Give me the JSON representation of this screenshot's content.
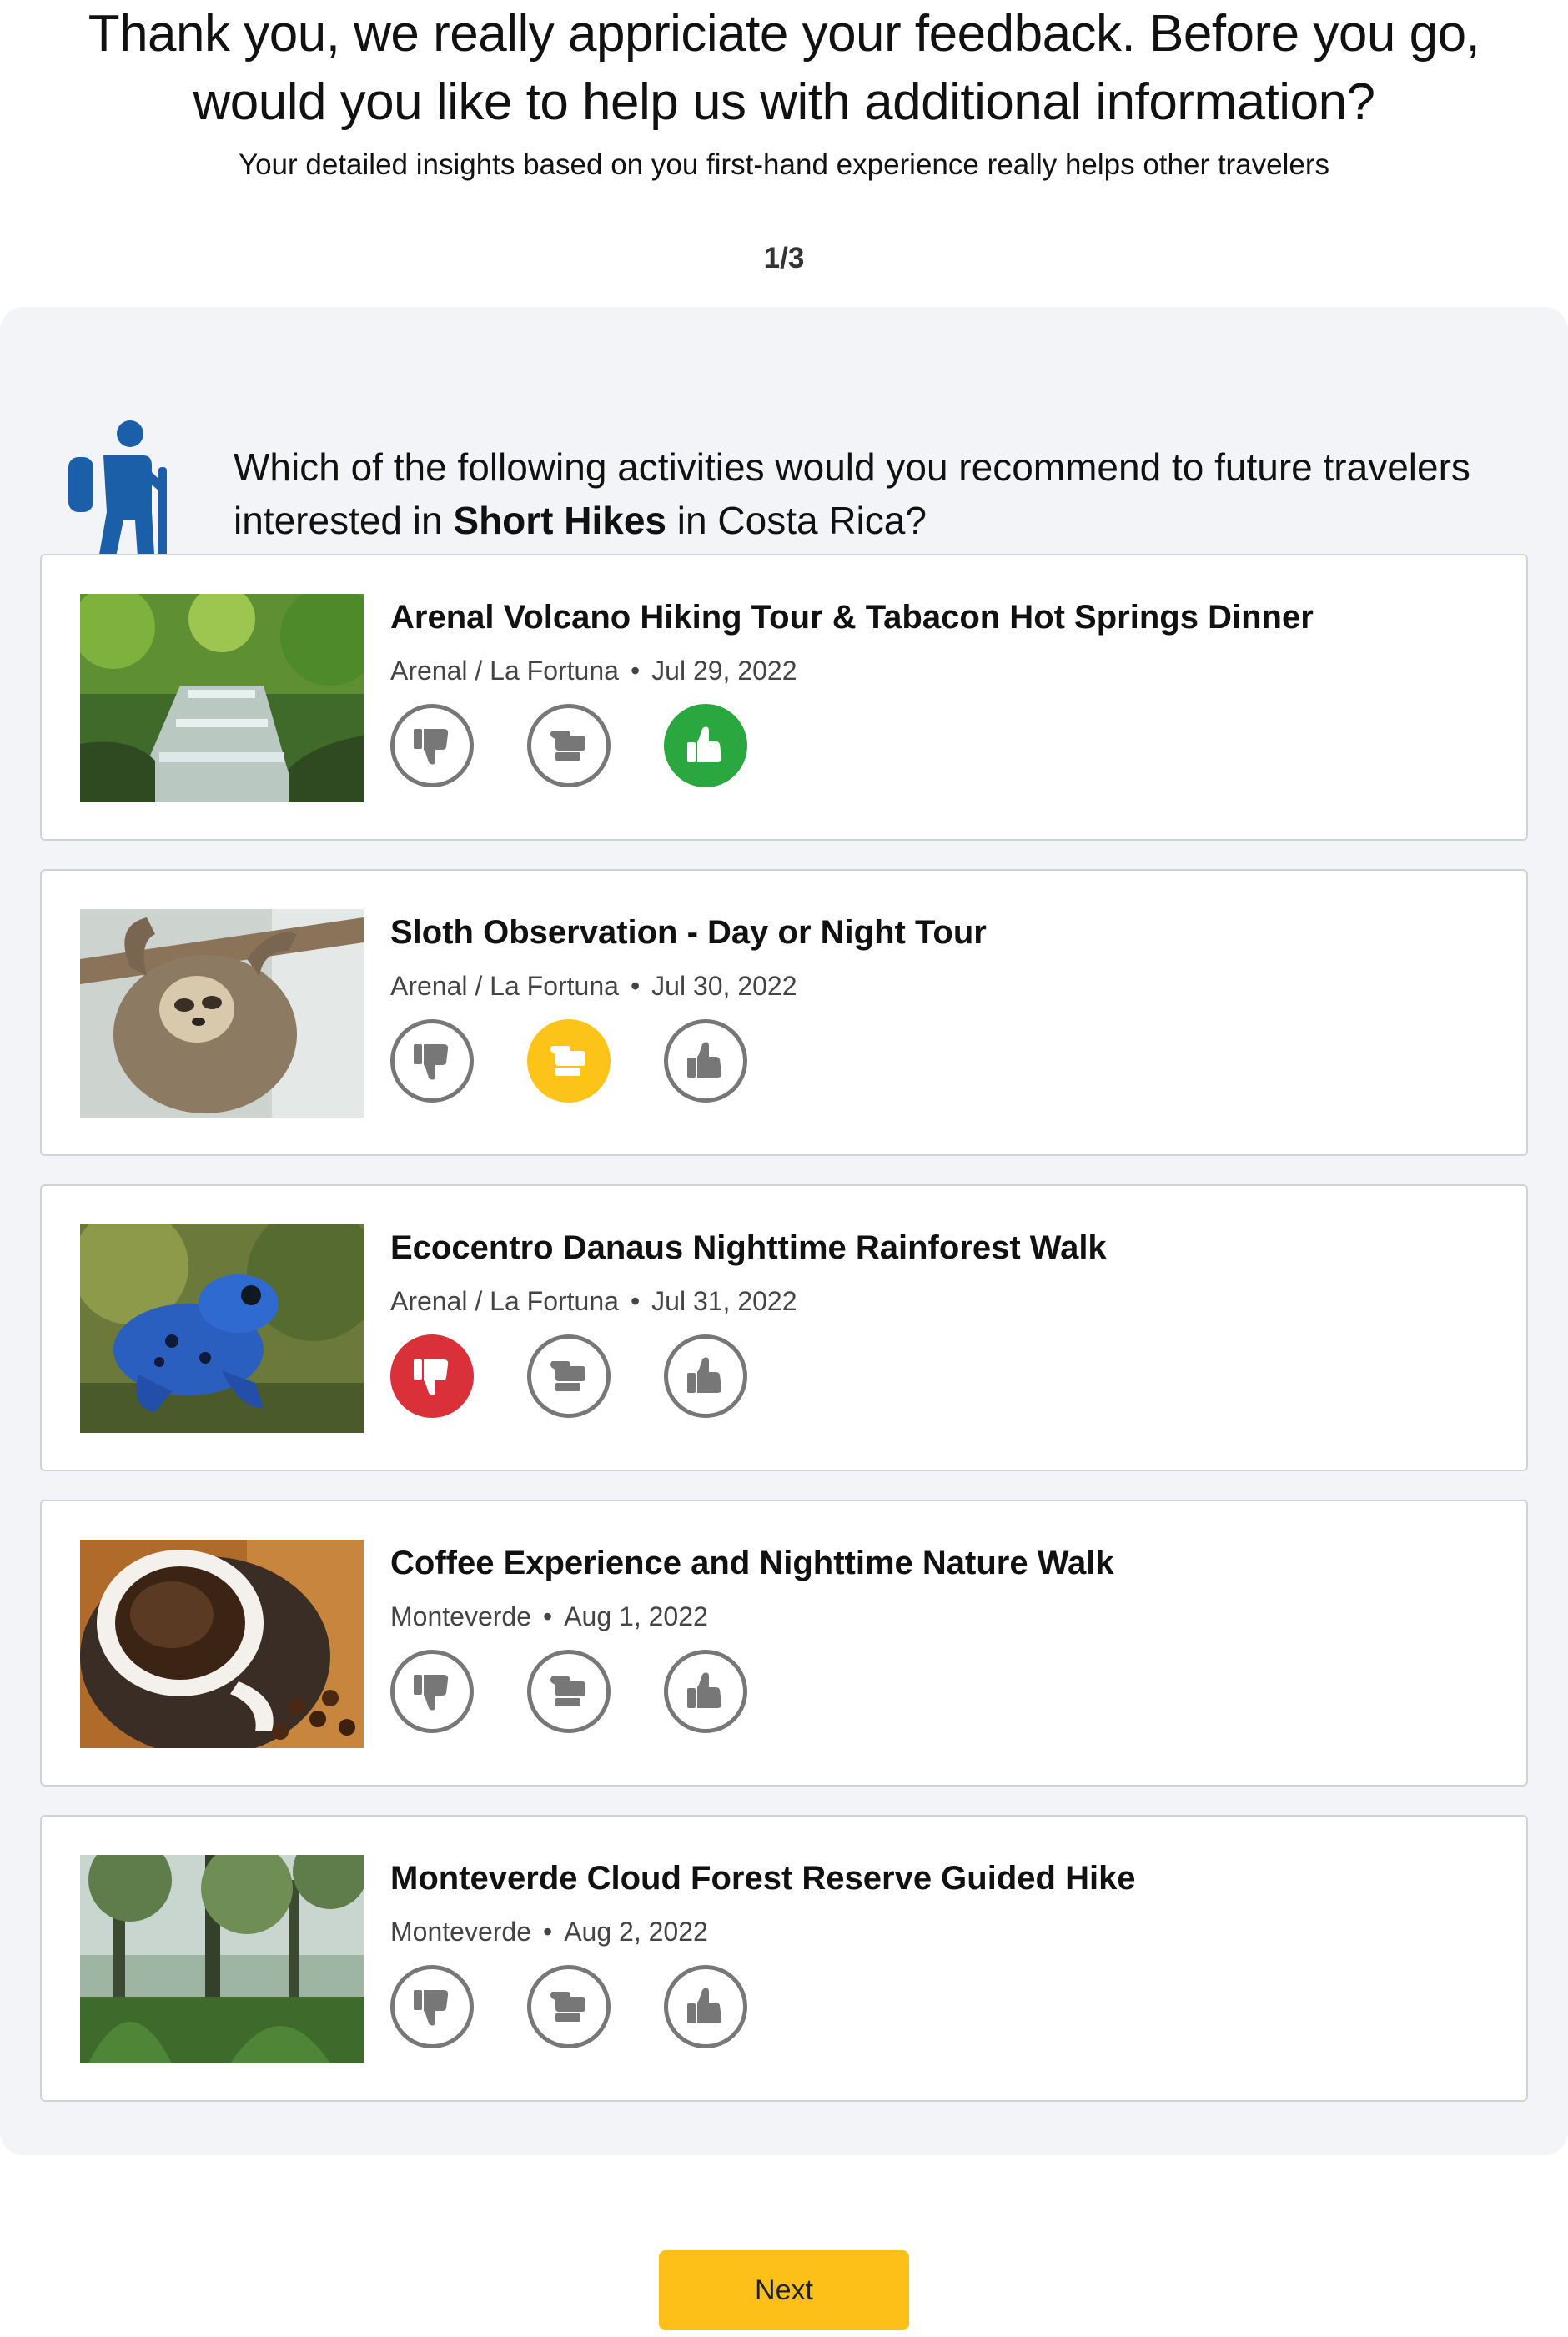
{
  "header": {
    "title_line1": "Thank you, we really appriciate your feedback. Before you go,",
    "title_line2": "would you like to help us with additional information?",
    "subtitle": "Your detailed insights based on you first-hand experience really helps other travelers"
  },
  "progress": "1/3",
  "question": {
    "icon": "hiker-icon",
    "prefix": "Which of the following activities would you recommend to future travelers interested in ",
    "topic": "Short Hikes",
    "suffix": " in Costa Rica?"
  },
  "activities": [
    {
      "title": "Arenal Volcano Hiking Tour & Tabacon Hot Springs Dinner",
      "location": "Arenal / La Fortuna",
      "date": "Jul 29, 2022",
      "selected": "up",
      "image": "waterfall-stream-photo"
    },
    {
      "title": "Sloth Observation - Day or Night Tour",
      "location": "Arenal / La Fortuna",
      "date": "Jul 30, 2022",
      "selected": "mid",
      "image": "sloth-photo"
    },
    {
      "title": "Ecocentro Danaus Nighttime Rainforest Walk",
      "location": "Arenal / La Fortuna",
      "date": "Jul 31, 2022",
      "selected": "down",
      "image": "blue-frog-photo"
    },
    {
      "title": "Coffee Experience and Nighttime Nature Walk",
      "location": "Monteverde",
      "date": "Aug 1, 2022",
      "selected": "none",
      "image": "coffee-cup-photo"
    },
    {
      "title": "Monteverde Cloud Forest Reserve Guided Hike",
      "location": "Monteverde",
      "date": "Aug 2, 2022",
      "selected": "none",
      "image": "cloud-forest-photo"
    }
  ],
  "vote_icons": [
    "thumbs-down-icon",
    "thumb-sideways-icon",
    "thumbs-up-icon"
  ],
  "colors": {
    "up": "#2aa83f",
    "mid": "#fcc419",
    "down": "#d9303a",
    "accent": "#fcc019",
    "hiker": "#1a5fa8"
  },
  "footer": {
    "next_label": "Next"
  }
}
